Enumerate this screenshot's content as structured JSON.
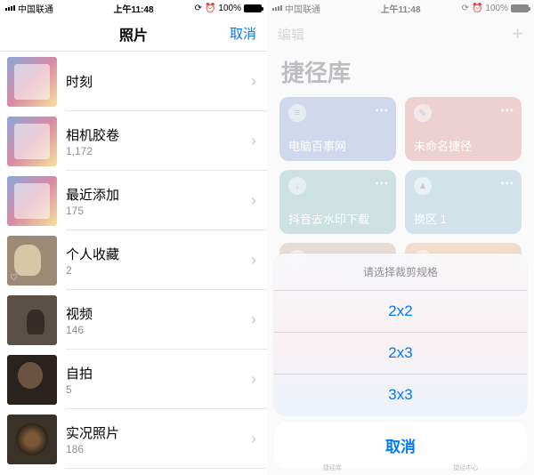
{
  "status": {
    "carrier": "中国联通",
    "time": "上午11:48",
    "battery_pct": "100%",
    "alarm_glyph": "⏰"
  },
  "left": {
    "nav": {
      "title": "照片",
      "cancel": "取消"
    },
    "albums": [
      {
        "title": "时刻",
        "count": ""
      },
      {
        "title": "相机胶卷",
        "count": "1,172"
      },
      {
        "title": "最近添加",
        "count": "175"
      },
      {
        "title": "个人收藏",
        "count": "2"
      },
      {
        "title": "视频",
        "count": "146"
      },
      {
        "title": "自拍",
        "count": "5"
      },
      {
        "title": "实况照片",
        "count": "186"
      }
    ]
  },
  "right": {
    "nav": {
      "edit": "编辑",
      "plus": "+"
    },
    "title": "捷径库",
    "cards": [
      {
        "label": "电脑百事网",
        "color": "blue",
        "icon": "≡"
      },
      {
        "label": "未命名捷径",
        "color": "red",
        "icon": "✎"
      },
      {
        "label": "抖音去水印下载",
        "color": "teal",
        "icon": "↓"
      },
      {
        "label": "换区 1",
        "color": "cyan",
        "icon": "▲"
      },
      {
        "label": "",
        "color": "brown",
        "icon": "☕"
      },
      {
        "label": "",
        "color": "orange",
        "icon": "↓"
      }
    ],
    "sheet": {
      "title": "请选择裁剪规格",
      "options": [
        "2x2",
        "2x3",
        "3x3"
      ],
      "cancel": "取消"
    },
    "tabbar": {
      "left": "捷径库",
      "right": "捷径中心"
    }
  }
}
